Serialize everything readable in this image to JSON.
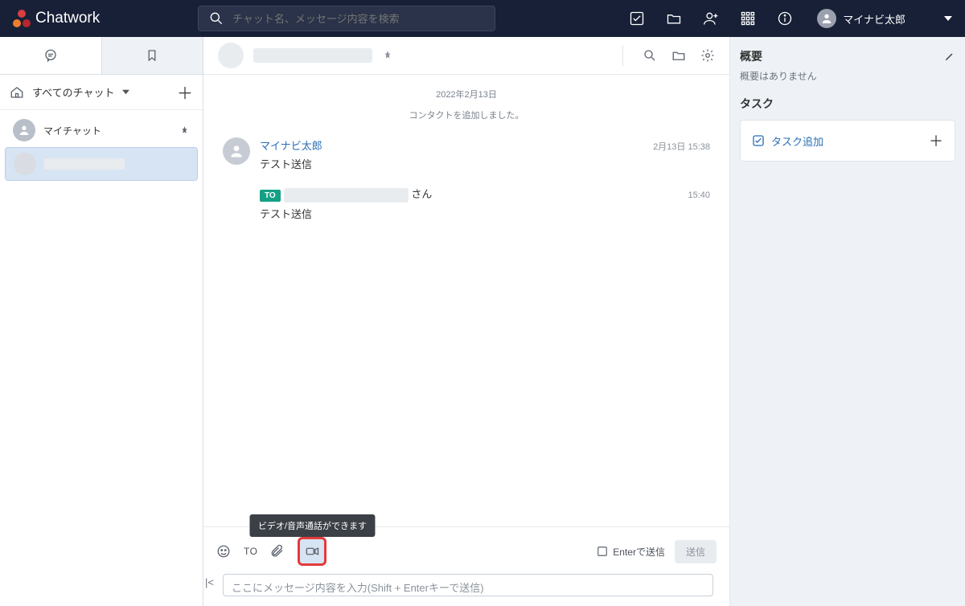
{
  "brand_name": "Chatwork",
  "search_placeholder": "チャット名、メッセージ内容を検索",
  "user_name": "マイナビ太郎",
  "sidebar": {
    "filter_label": "すべてのチャット",
    "items": [
      {
        "label": "マイチャット",
        "pinned": true,
        "selected": false
      },
      {
        "label": "████████",
        "pinned": false,
        "selected": true
      }
    ]
  },
  "chat_header": {
    "name": "████████"
  },
  "timeline": {
    "date_separator": "2022年2月13日",
    "system_message": "コンタクトを追加しました。",
    "messages": [
      {
        "sender": "マイナビ太郎",
        "time": "2月13日 15:38",
        "body": "テスト送信"
      },
      {
        "to_badge": "TO",
        "to_name": "████████",
        "to_suffix": "さん",
        "time": "15:40",
        "body": "テスト送信"
      }
    ]
  },
  "composer": {
    "to_label": "TO",
    "enter_send_label": "Enterで送信",
    "send_button": "送信",
    "placeholder": "ここにメッセージ内容を入力(Shift + Enterキーで送信)",
    "video_tooltip": "ビデオ/音声通話ができます"
  },
  "right_panel": {
    "summary_title": "概要",
    "summary_empty": "概要はありません",
    "task_title": "タスク",
    "task_add_label": "タスク追加"
  }
}
